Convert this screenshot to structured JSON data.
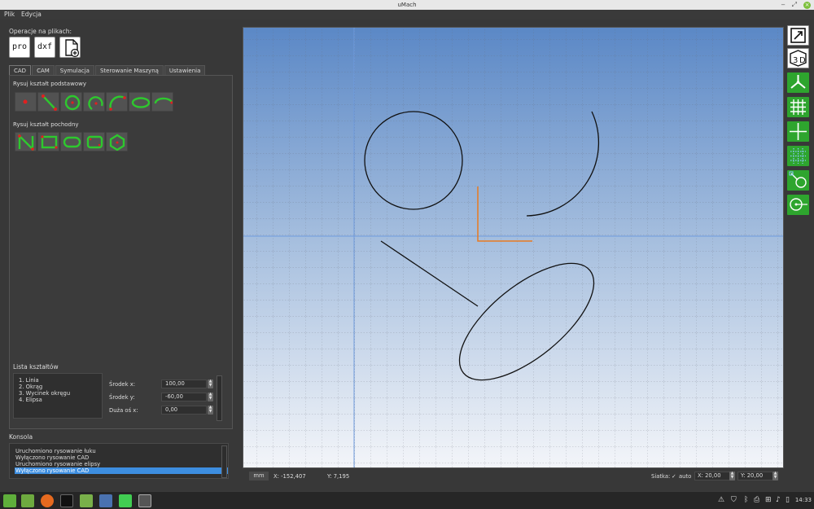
{
  "window": {
    "title": "uMach",
    "minimize_glyph": "‒",
    "maximize_glyph": "⤢",
    "close_glyph": "×"
  },
  "menu": [
    "Plik",
    "Edycja"
  ],
  "file_ops": {
    "label": "Operacje na plikach:",
    "buttons": [
      {
        "name": "pro-file-button",
        "text": "pro"
      },
      {
        "name": "dxf-file-button",
        "text": "dxf"
      },
      {
        "name": "new-file-button",
        "text": ""
      }
    ]
  },
  "tabs": [
    "CAD",
    "CAM",
    "Symulacja",
    "Sterowanie Maszyną",
    "Ustawienia"
  ],
  "active_tab": 0,
  "basic_shapes": {
    "label": "Rysuj kształt podstawowy",
    "tools": [
      "point-tool-icon",
      "line-tool-icon",
      "circle-tool-icon",
      "arc-tool-icon",
      "arc-3point-tool-icon",
      "ellipse-tool-icon",
      "ellipse-arc-tool-icon"
    ]
  },
  "derived_shapes": {
    "label": "Rysuj kształt pochodny",
    "tools": [
      "polyline-tool-icon",
      "rectangle-tool-icon",
      "slot-tool-icon",
      "rounded-rectangle-tool-icon",
      "polygon-tool-icon"
    ]
  },
  "shape_list": {
    "label": "Lista kształtów",
    "items": [
      "1. Linia",
      "2. Okrąg",
      "3. Wycinek okręgu",
      "4. Elipsa"
    ],
    "properties": [
      {
        "label": "Środek x:",
        "value": "100,00"
      },
      {
        "label": "Środek y:",
        "value": "-60,00"
      },
      {
        "label": "Duża oś x:",
        "value": "0,00"
      }
    ]
  },
  "console": {
    "label": "Konsola",
    "lines": [
      "Uruchomiono rysowanie łuku",
      "Wyłączono rysowanie CAD",
      "Uruchomiono rysowanie elipsy",
      "Wyłączono rysowanie CAD"
    ],
    "selected_index": 3
  },
  "status": {
    "unit": "mm",
    "x_readout": "X: -152,407",
    "y_readout": "Y: 7,195",
    "grid_label": "Siatka:",
    "grid_check": "✓",
    "auto_label": "auto",
    "grid_x": "X: 20,00",
    "grid_y": "Y: 20,00"
  },
  "right_toolbar": [
    "fit-view-icon",
    "3d-view-icon",
    "axes-icon",
    "grid-icon",
    "crosshair-icon",
    "snap-grid-icon",
    "snap-object-icon",
    "snap-center-icon"
  ],
  "taskbar": {
    "clock": "14:33"
  },
  "colors": {
    "accent": "#3d8ee0",
    "tool_green": "#2ea52e",
    "point_red": "#e02020",
    "origin_orange": "#e87a20"
  }
}
